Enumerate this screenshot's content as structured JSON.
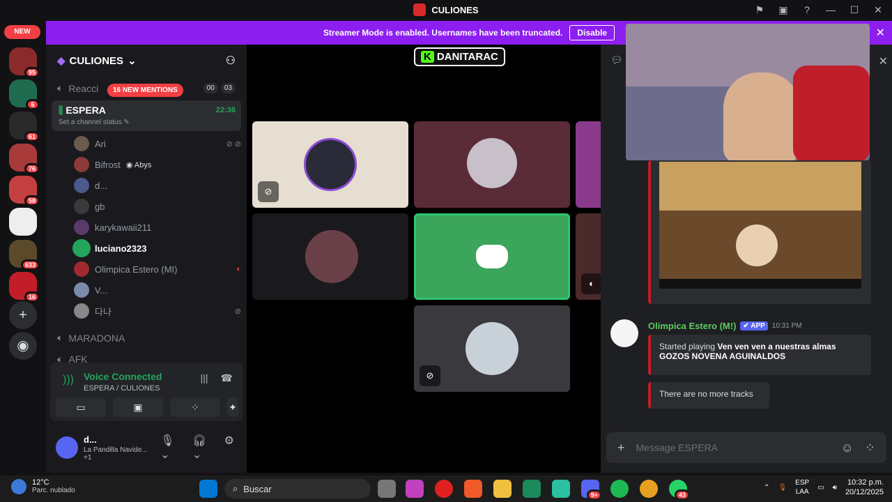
{
  "window": {
    "title": "CULIONES"
  },
  "banner": {
    "text": "Streamer Mode is enabled. Usernames have been truncated.",
    "button": "Disable"
  },
  "guilds": {
    "new_label": "NEW",
    "badges": [
      "95",
      "6",
      "61",
      "76",
      "58",
      "633",
      "16"
    ]
  },
  "server": {
    "name": "CULIONES"
  },
  "channels": {
    "reacciones": "Reacci",
    "mentions_pill": "16 NEW MENTIONS",
    "counts": [
      "00",
      "03"
    ],
    "espera_name": "ESPERA",
    "espera_status": "Set a channel status",
    "espera_time": "22:36",
    "maradona": "MARADONA",
    "afk": "AFK"
  },
  "voice_users": [
    {
      "name": "Ari"
    },
    {
      "name": "Bifrost",
      "tag": "Abys"
    },
    {
      "name": "d..."
    },
    {
      "name": "gb"
    },
    {
      "name": "karykawaii211"
    },
    {
      "name": "luciano2323"
    },
    {
      "name": "Olimpica Estero (MI)"
    },
    {
      "name": "V..."
    },
    {
      "name": "다나"
    }
  ],
  "voice_panel": {
    "title": "Voice Connected",
    "subtitle": "ESPERA / CULIONES"
  },
  "user_panel": {
    "name": "d...",
    "status": "La Pandilla Navide...",
    "extra": "+1"
  },
  "stage": {
    "watermark": "DANITARAC",
    "watermark_k": "K"
  },
  "chat": {
    "author": "Olimpica Estero (M!)",
    "app_tag": "APP",
    "time": "10:31 PM",
    "playing_prefix": "Started playing",
    "playing_song": "Ven ven ven a nuestras almas GOZOS NOVENA AGUINALDOS",
    "no_more": "There are no more tracks",
    "placeholder": "Message ESPERA"
  },
  "taskbar": {
    "temp": "12°C",
    "condition": "Parc. nublado",
    "search": "Buscar",
    "lang_top": "ESP",
    "lang_bottom": "LAA",
    "time": "10:32 p.m.",
    "date": "20/12/2025",
    "discord_badge": "9+",
    "whatsapp_badge": "43"
  },
  "colors": {
    "accent": "#5865f2",
    "banner": "#8d1ef0",
    "online": "#23a55a",
    "danger": "#f23f43"
  }
}
